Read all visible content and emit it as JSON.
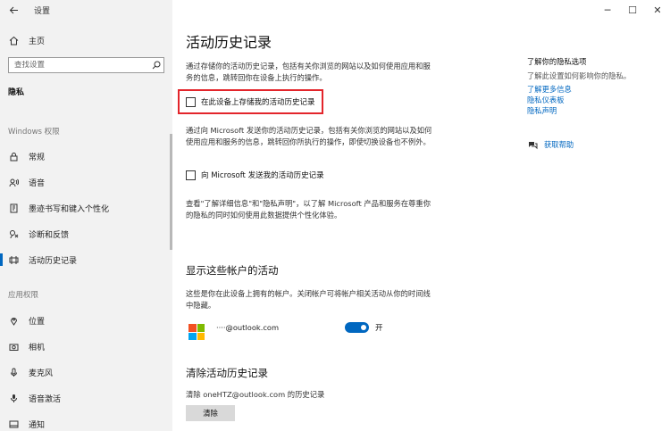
{
  "window": {
    "app_title": "设置",
    "controls": {
      "minimize": "─",
      "maximize": "☐",
      "close": "✕"
    }
  },
  "sidebar": {
    "home_label": "主页",
    "search_placeholder": "查找设置",
    "privacy_heading": "隐私",
    "windows_permissions_heading": "Windows 权限",
    "windows_items": [
      {
        "label": "常规",
        "icon": "lock-icon"
      },
      {
        "label": "语音",
        "icon": "speech-icon"
      },
      {
        "label": "墨迹书写和键入个性化",
        "icon": "pen-icon"
      },
      {
        "label": "诊断和反馈",
        "icon": "diagnostics-icon"
      },
      {
        "label": "活动历史记录",
        "icon": "activity-icon",
        "active": true
      }
    ],
    "app_permissions_heading": "应用权限",
    "app_items": [
      {
        "label": "位置",
        "icon": "location-icon"
      },
      {
        "label": "相机",
        "icon": "camera-icon"
      },
      {
        "label": "麦克风",
        "icon": "microphone-icon"
      },
      {
        "label": "语音激活",
        "icon": "voice-activation-icon"
      },
      {
        "label": "通知",
        "icon": "notification-icon"
      }
    ]
  },
  "main": {
    "title": "活动历史记录",
    "intro": "通过存储你的活动历史记录，包括有关你浏览的网站以及如何使用应用和服务的信息，跳转回你在设备上执行的操作。",
    "store_checkbox_label": "在此设备上存储我的活动历史记录",
    "store_checked": false,
    "send_description": "通过向 Microsoft 发送你的活动历史记录，包括有关你浏览的网站以及如何使用应用和服务的信息，跳转回你所执行的操作，即使切换设备也不例外。",
    "send_checkbox_label": "向 Microsoft 发送我的活动历史记录",
    "send_checked": false,
    "more_info": "查看\"了解详细信息\"和\"隐私声明\"，以了解 Microsoft 产品和服务在尊重你的隐私的同时如何使用此数据提供个性化体验。",
    "accounts_title": "显示这些帐户的活动",
    "accounts_description": "这些是你在此设备上拥有的帐户。关闭帐户可将帐户相关活动从你的时间线中隐藏。",
    "account_email": "····@outlook.com",
    "account_toggle_state": "开",
    "account_toggle_on": true,
    "clear_title": "清除活动历史记录",
    "clear_description": "清除 oneHTZ@outlook.com 的历史记录",
    "clear_button": "清除"
  },
  "right_panel": {
    "heading": "了解你的隐私选项",
    "text": "了解此设置如何影响你的隐私。",
    "links": [
      "了解更多信息",
      "隐私仪表板",
      "隐私声明"
    ],
    "feedback_label": "获取帮助"
  },
  "colors": {
    "accent": "#0067c0",
    "highlight": "#e3252b",
    "sidebar_bg": "#f2f2f2"
  }
}
